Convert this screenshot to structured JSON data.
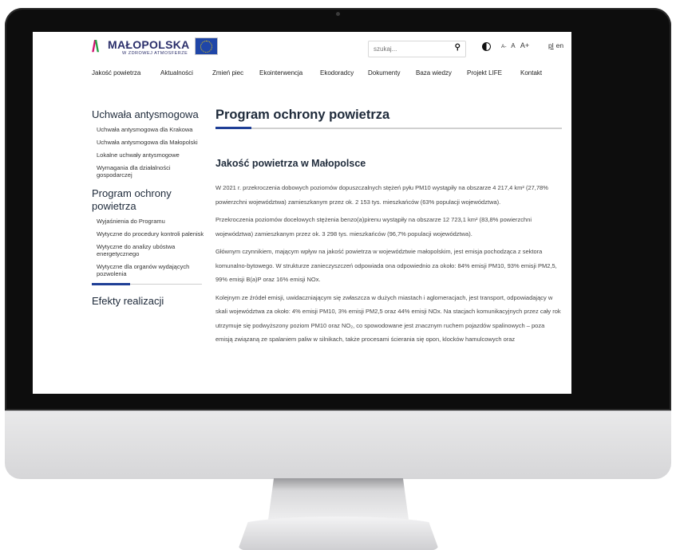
{
  "header": {
    "logo": {
      "name": "MAŁOPOLSKA",
      "tagline": "W ZDROWEJ ATMOSFERZE"
    },
    "search": {
      "placeholder": "szukaj...",
      "icon": "search-icon"
    },
    "font_sizes": [
      "A-",
      "A",
      "A+"
    ],
    "languages": [
      "pl",
      "en"
    ]
  },
  "nav": [
    "Jakość powietrza",
    "Aktualności",
    "Zmień piec",
    "Ekointerwencja",
    "Ekodoradcy",
    "Dokumenty",
    "Baza wiedzy",
    "Projekt LIFE",
    "Kontakt"
  ],
  "sidebar": {
    "groups": [
      {
        "heading": "Uchwała antysmogowa",
        "links": [
          "Uchwała antysmogowa dla Krakowa",
          "Uchwała antysmogowa dla Małopolski",
          "Lokalne uchwały antysmogowe",
          "Wymagania dla działalności gospodarczej"
        ]
      },
      {
        "heading": "Program ochrony powietrza",
        "links": [
          "Wyjaśnienia do Programu",
          "Wytyczne do procedury kontroli palenisk",
          "Wytyczne do analizy ubóstwa energetycznego",
          "Wytyczne dla organów wydających pozwolenia"
        ]
      },
      {
        "heading": "Efekty realizacji",
        "links": []
      }
    ]
  },
  "main": {
    "page_title": "Program ochrony powietrza",
    "section_title": "Jakość powietrza w Małopolsce",
    "paragraphs": [
      "W 2021 r. przekroczenia dobowych poziomów dopuszczalnych stężeń pyłu PM10 wystąpiły na obszarze 4 217,4 km² (27,78% powierzchni województwa) zamieszkanym przez ok. 2 153 tys. mieszkańców (63% populacji województwa).",
      "Przekroczenia poziomów docelowych stężenia benzo(a)pirenu wystąpiły na obszarze 12 723,1 km² (83,8% powierzchni województwa) zamieszkanym przez ok. 3 298 tys. mieszkańców (96,7% populacji województwa).",
      "Głównym czynnikiem, mającym wpływ na jakość powietrza w województwie małopolskim, jest emisja pochodząca z sektora komunalno-bytowego. W strukturze zanieczyszczeń odpowiada ona odpowiednio za około: 84% emisji PM10, 93% emisji PM2,5, 99% emisji B(a)P oraz 16% emisji NOx.",
      "Kolejnym ze źródeł emisji, uwidaczniającym się zwłaszcza w dużych miastach i aglomeracjach, jest transport, odpowiadający w skali województwa za około: 4% emisji PM10, 3% emisji PM2,5 oraz 44% emisji NOx. Na stacjach komunikacyjnych przez cały rok utrzymuje się podwyższony poziom PM10 oraz NO₂, co spowodowane jest znacznym ruchem pojazdów spalinowych – poza emisją związaną ze spalaniem paliw w silnikach, także procesami ścierania się opon, klocków hamulcowych oraz"
    ]
  },
  "colors": {
    "brand_navy": "#1f3f96",
    "logo_magenta": "#d0106f",
    "logo_green": "#27a045",
    "heading": "#1e2a3a"
  }
}
